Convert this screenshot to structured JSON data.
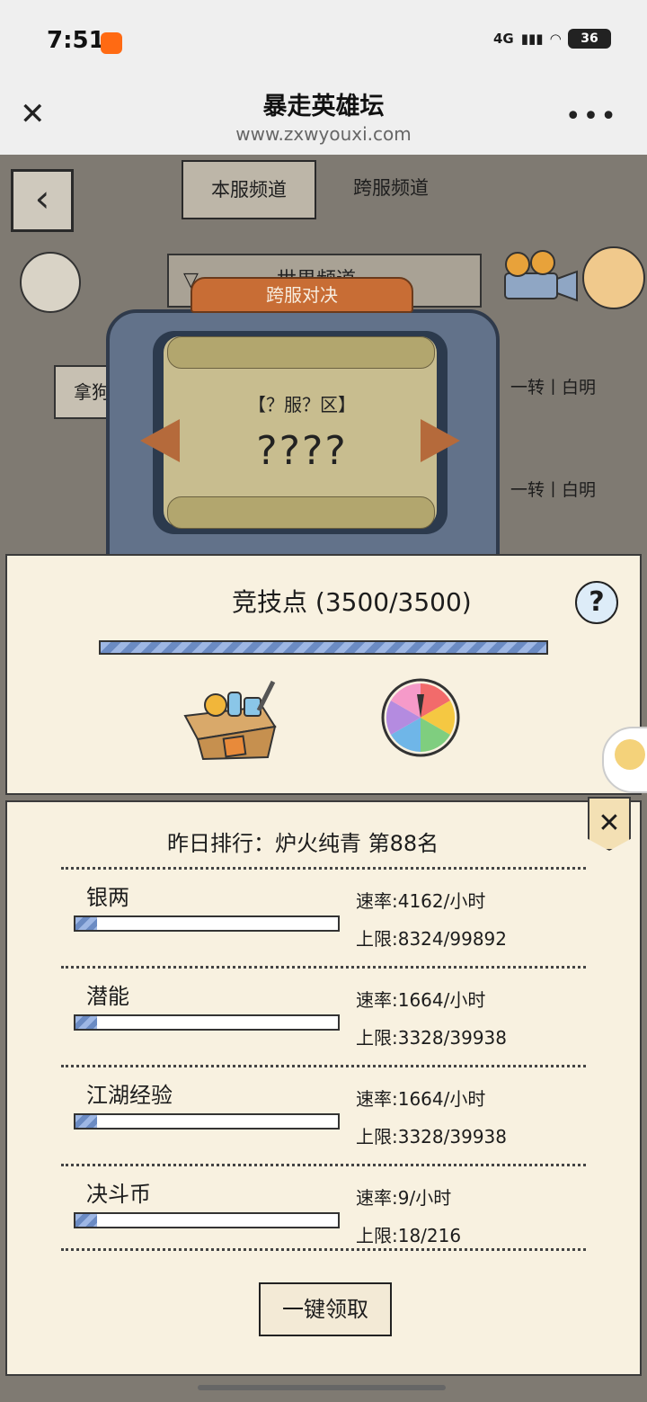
{
  "status": {
    "time": "7:51",
    "network": "4G",
    "battery": "36"
  },
  "browser": {
    "title": "暴走英雄坛",
    "url": "www.zxwyouxi.com"
  },
  "game": {
    "tabs": [
      {
        "label": "本服频道"
      },
      {
        "label": "跨服频道"
      }
    ],
    "channel": "世界频道",
    "player_button": "拿狗",
    "rank_labels": [
      "一转丨白明",
      "一转丨白明"
    ],
    "board": {
      "header": "跨服对决",
      "server": "【？服？区】",
      "opponent": "????"
    }
  },
  "arena": {
    "title": "竞技点 (3500/3500)",
    "points_fraction": 1.0
  },
  "rewards": {
    "ranking": "昨日排行：炉火纯青 第88名",
    "items": [
      {
        "name": "银两",
        "rate": "速率:4162/小时",
        "limit": "上限:8324/99892",
        "fill": 0.083
      },
      {
        "name": "潜能",
        "rate": "速率:1664/小时",
        "limit": "上限:3328/39938",
        "fill": 0.083
      },
      {
        "name": "江湖经验",
        "rate": "速率:1664/小时",
        "limit": "上限:3328/39938",
        "fill": 0.083
      },
      {
        "name": "决斗币",
        "rate": "速率:9/小时",
        "limit": "上限:18/216",
        "fill": 0.083
      }
    ],
    "claim_button": "一键领取"
  },
  "colors": {
    "panel": "#f8f1e0",
    "accent": "#c86d35",
    "bar": "#6b8bc3"
  }
}
